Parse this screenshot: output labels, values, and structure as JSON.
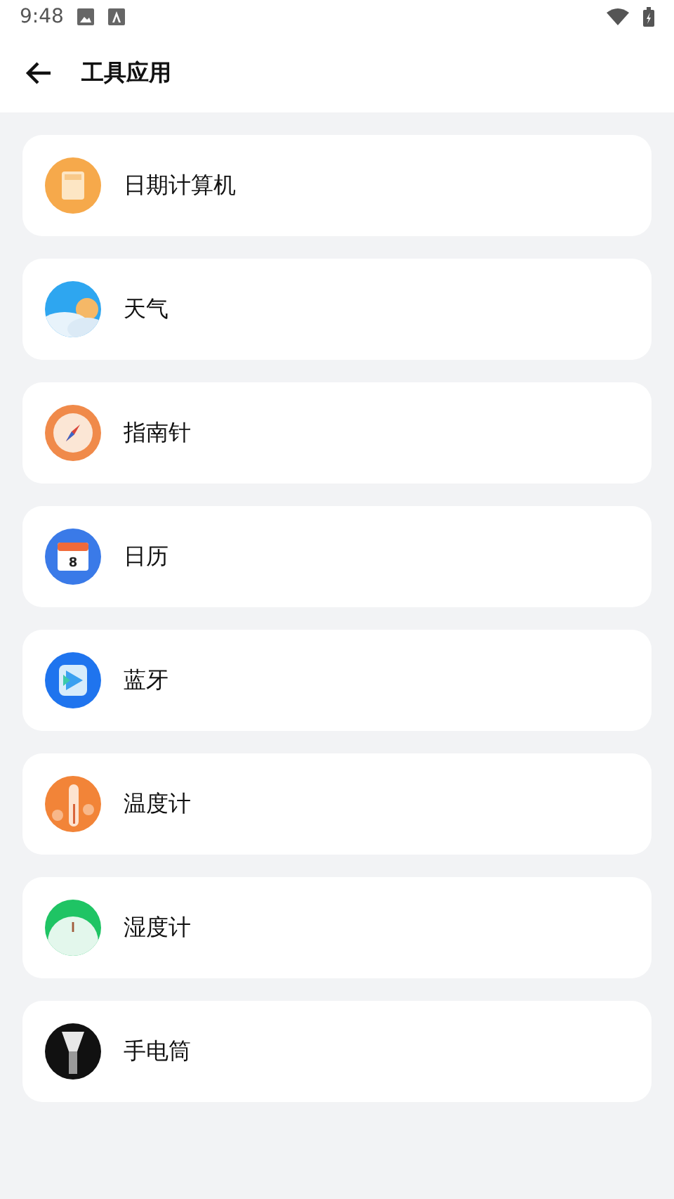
{
  "status_bar": {
    "time": "9:48"
  },
  "header": {
    "title": "工具应用"
  },
  "tools": [
    {
      "kind": "datecalc",
      "label": "日期计算机"
    },
    {
      "kind": "weather",
      "label": "天气"
    },
    {
      "kind": "compass",
      "label": "指南针"
    },
    {
      "kind": "calendar",
      "label": "日历",
      "icon_text": "8"
    },
    {
      "kind": "bluetooth",
      "label": "蓝牙"
    },
    {
      "kind": "thermometer",
      "label": "温度计"
    },
    {
      "kind": "hygrometer",
      "label": "湿度计"
    },
    {
      "kind": "flashlight",
      "label": "手电筒"
    }
  ]
}
